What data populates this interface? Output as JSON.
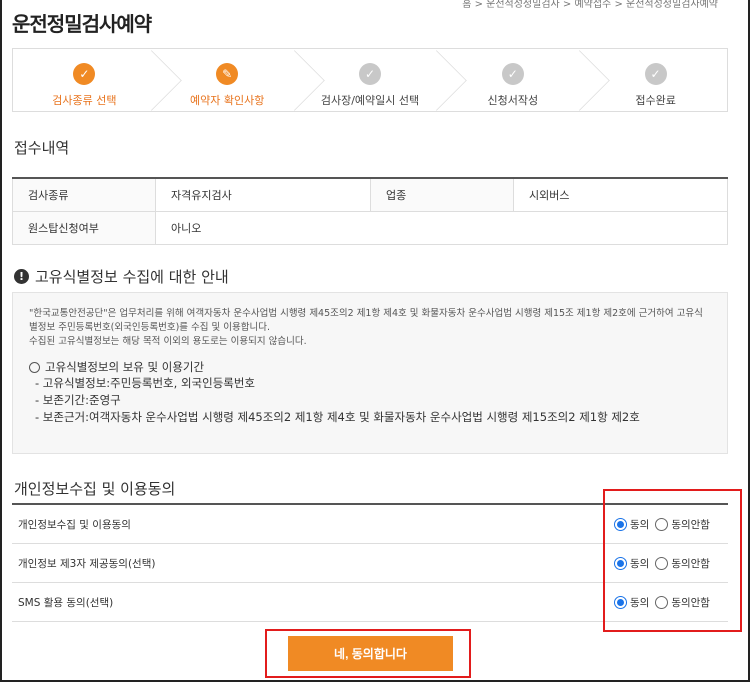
{
  "breadcrumb": "홈 > 운전적성정밀검사 > 예약접수 > 운전적성정밀검사예약",
  "page_title": "운전정밀검사예약",
  "steps": [
    {
      "label": "검사종류 선택",
      "state": "active",
      "icon": "check-icon"
    },
    {
      "label": "예약자 확인사항",
      "state": "active",
      "icon": "pencil-icon"
    },
    {
      "label": "검사장/예약일시 선택",
      "state": "inactive",
      "icon": "check-icon"
    },
    {
      "label": "신청서작성",
      "state": "inactive",
      "icon": "check-icon"
    },
    {
      "label": "접수완료",
      "state": "inactive",
      "icon": "check-icon"
    }
  ],
  "receipt": {
    "title": "접수내역",
    "rows": [
      [
        "검사종류",
        "자격유지검사",
        "업종",
        "시외버스"
      ],
      [
        "원스탑신청여부",
        "아니오"
      ]
    ]
  },
  "notice": {
    "title": "고유식별정보 수집에 대한 안내",
    "paragraph": [
      "\"한국교통안전공단\"은 업무처리를 위해 여객자동차 운수사업법 시행령 제45조의2 제1항 제4호 및 화물자동차 운수사업법 시행령 제15조 제1항 제2호에 근거하여 고유식",
      "별정보 주민등록번호(외국인등록번호)를 수집 및 이용합니다.",
      "수집된 고유식별정보는 해당 목적 이외의 용도로는 이용되지 않습니다."
    ],
    "hold_title": "고유식별정보의 보유 및 이용기간",
    "hold_items": [
      "- 고유식별정보:주민등록번호, 외국인등록번호",
      "- 보존기간:준영구",
      "- 보존근거:여객자동차 운수사업법 시행령 제45조의2 제1항 제4호 및 화물자동차 운수사업법 시행령 제15조의2 제1항 제2호"
    ]
  },
  "consent": {
    "title": "개인정보수집 및 이용동의",
    "agree_label": "동의",
    "disagree_label": "동의안함",
    "items": [
      {
        "label": "개인정보수집 및 이용동의",
        "selected": "agree"
      },
      {
        "label": "개인정보 제3자 제공동의(선택)",
        "selected": "agree"
      },
      {
        "label": "SMS 활용 동의(선택)",
        "selected": "agree"
      }
    ]
  },
  "agree_button": "네, 동의합니다",
  "colors": {
    "accent": "#f08a24",
    "highlight": "#e21c1c",
    "radio": "#1a73e8"
  }
}
